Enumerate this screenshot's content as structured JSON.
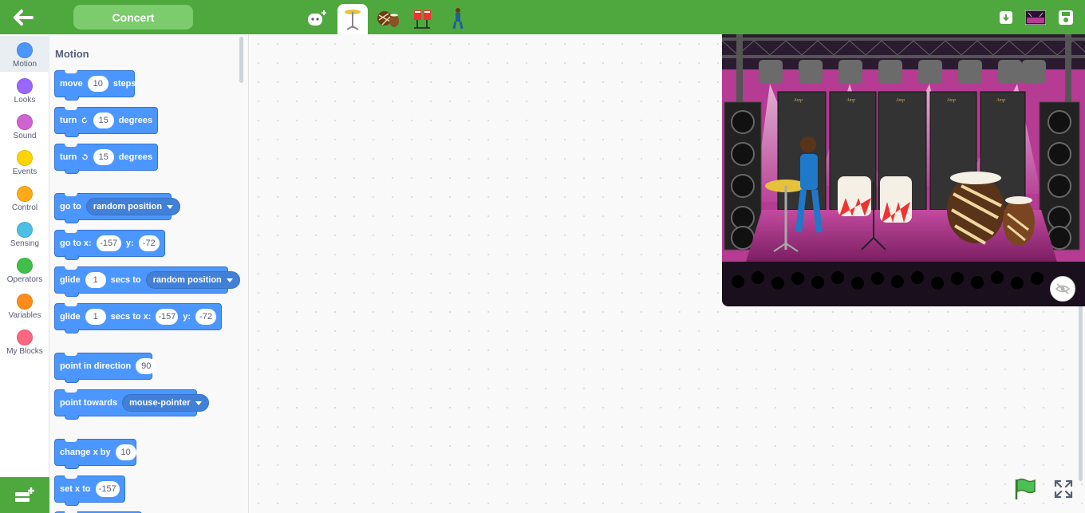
{
  "header": {
    "project_title": "Concert",
    "sprites": [
      "add-sprite",
      "cymbal",
      "tabla",
      "drums",
      "singer"
    ]
  },
  "categories": [
    {
      "label": "Motion",
      "color": "#4c97ff"
    },
    {
      "label": "Looks",
      "color": "#9966ff"
    },
    {
      "label": "Sound",
      "color": "#cf63cf"
    },
    {
      "label": "Events",
      "color": "#ffd500"
    },
    {
      "label": "Control",
      "color": "#ffab19"
    },
    {
      "label": "Sensing",
      "color": "#4cbfe6"
    },
    {
      "label": "Operators",
      "color": "#40bf4a"
    },
    {
      "label": "Variables",
      "color": "#ff8c1a"
    },
    {
      "label": "My Blocks",
      "color": "#ff6680"
    }
  ],
  "palette": {
    "title": "Motion",
    "move": {
      "label": "move",
      "value": "10",
      "suffix": "steps"
    },
    "turn_right": {
      "label": "turn",
      "value": "15",
      "suffix": "degrees"
    },
    "turn_left": {
      "label": "turn",
      "value": "15",
      "suffix": "degrees"
    },
    "go_to": {
      "label": "go to",
      "option": "random position"
    },
    "go_to_xy": {
      "label": "go to x:",
      "x": "-157",
      "ylabel": "y:",
      "y": "-72"
    },
    "glide": {
      "label": "glide",
      "value": "1",
      "mid": "secs to",
      "option": "random position"
    },
    "glide_xy": {
      "label": "glide",
      "value": "1",
      "mid": "secs to x:",
      "x": "-157",
      "ylabel": "y:",
      "y": "-72"
    },
    "point_dir": {
      "label": "point in direction",
      "value": "90"
    },
    "point_towards": {
      "label": "point towards",
      "option": "mouse-pointer"
    },
    "change_x": {
      "label": "change x by",
      "value": "10"
    },
    "set_x": {
      "label": "set x to",
      "value": "-157"
    }
  },
  "stage": {
    "amp_label": "Amp"
  },
  "colors": {
    "topbar": "#4ea83e",
    "motion": "#4c97ff",
    "stage_bg": "#b53b93"
  }
}
